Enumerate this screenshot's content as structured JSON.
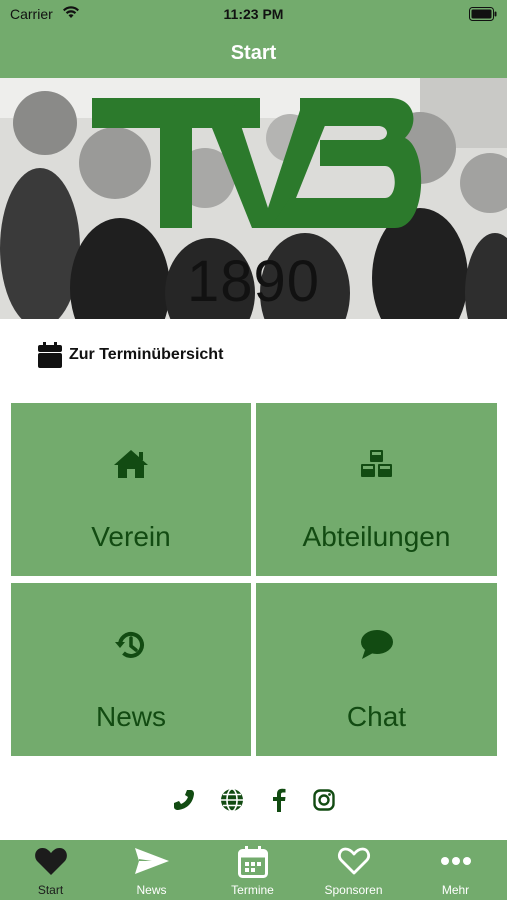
{
  "status_bar": {
    "carrier": "Carrier",
    "time": "11:23 PM"
  },
  "nav": {
    "title": "Start"
  },
  "hero": {
    "logo_text": "TVB",
    "year": "1890"
  },
  "schedule": {
    "label": "Zur Terminübersicht",
    "icon": "calendar-icon"
  },
  "tiles": [
    {
      "label": "Verein",
      "icon": "home-icon"
    },
    {
      "label": "Abteilungen",
      "icon": "cubes-icon"
    },
    {
      "label": "News",
      "icon": "history-icon"
    },
    {
      "label": "Chat",
      "icon": "chat-bubble-icon"
    }
  ],
  "social": [
    "phone-icon",
    "globe-icon",
    "facebook-icon",
    "instagram-icon"
  ],
  "tab_bar": {
    "items": [
      {
        "label": "Start",
        "icon": "heart-filled-icon",
        "active": true
      },
      {
        "label": "News",
        "icon": "send-icon",
        "active": false
      },
      {
        "label": "Termine",
        "icon": "calendar-icon",
        "active": false
      },
      {
        "label": "Sponsoren",
        "icon": "heart-outline-icon",
        "active": false
      },
      {
        "label": "Mehr",
        "icon": "more-dots-icon",
        "active": false
      }
    ]
  },
  "colors": {
    "brand_green": "#73ab6d",
    "dark_green": "#124b12",
    "logo_green": "#2c7a2c"
  }
}
